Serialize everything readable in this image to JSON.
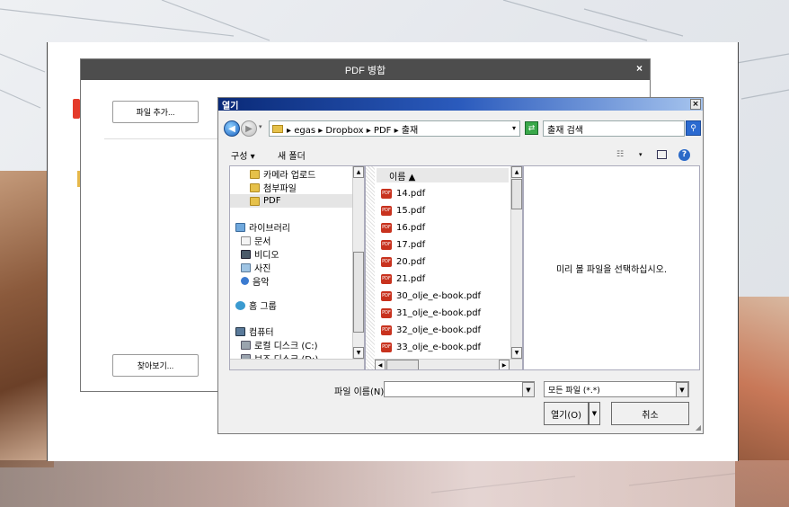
{
  "merge_dialog": {
    "title": "PDF 병합",
    "close_glyph": "×",
    "add_file_button": "파일 추가...",
    "browse_button": "찾아보기..."
  },
  "open_dialog": {
    "title": "열기",
    "close_glyph": "×",
    "address": "▸ egas ▸ Dropbox ▸ PDF ▸ 출재",
    "search_placeholder": "출재 검색",
    "toolbar": {
      "organize": "구성 ▾",
      "new_folder": "새 폴더"
    },
    "nav_items": [
      {
        "label": "카메라 업로드",
        "icon": "folder-icon"
      },
      {
        "label": "첨부파일",
        "icon": "folder-icon"
      },
      {
        "label": "PDF",
        "icon": "folder-icon",
        "selected": true
      },
      {
        "label": "라이브러리",
        "icon": "library-icon"
      },
      {
        "label": "문서",
        "icon": "document-icon"
      },
      {
        "label": "비디오",
        "icon": "video-icon"
      },
      {
        "label": "사진",
        "icon": "picture-icon"
      },
      {
        "label": "음악",
        "icon": "music-icon"
      },
      {
        "label": "홈 그룹",
        "icon": "homegroup-icon"
      },
      {
        "label": "컴퓨터",
        "icon": "computer-icon"
      },
      {
        "label": "로컬 디스크 (C:)",
        "icon": "drive-icon"
      },
      {
        "label": "보조 디스크 (D:)",
        "icon": "drive-icon"
      }
    ],
    "column_header": "이름 ▲",
    "files": [
      "14.pdf",
      "15.pdf",
      "16.pdf",
      "17.pdf",
      "20.pdf",
      "21.pdf",
      "30_olje_e-book.pdf",
      "31_olje_e-book.pdf",
      "32_olje_e-book.pdf",
      "33_olje_e-book.pdf"
    ],
    "preview_message": "미리 볼 파일을 선택하십시오.",
    "filename_label": "파일 이름(N):",
    "filename_value": "",
    "file_type": "모든 파일 (*.*)",
    "open_button": "열기(O)",
    "cancel_button": "취소"
  }
}
